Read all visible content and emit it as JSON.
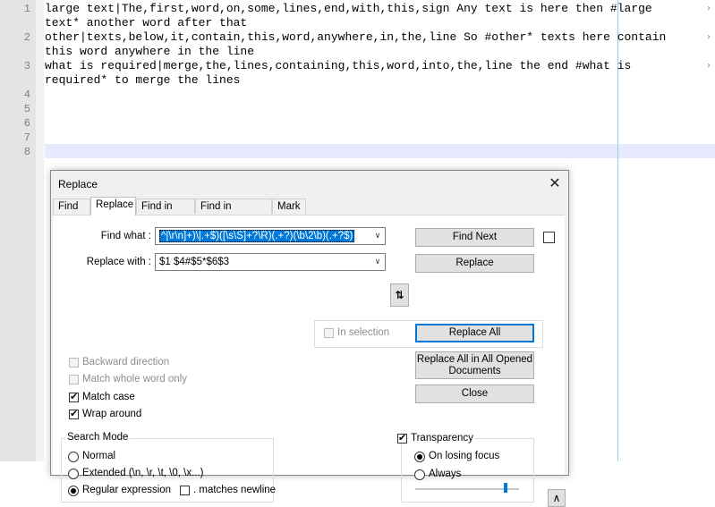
{
  "editor": {
    "line_numbers": [
      "1",
      "2",
      "3",
      "4",
      "5",
      "6",
      "7",
      "8"
    ],
    "lines": [
      "large text|The,first,word,on,some,lines,end,with,this,sign Any text is here then #large",
      "text* another word after that",
      "other|texts,below,it,contain,this,word,anywhere,in,the,line So #other* texts here contain",
      "this word anywhere in the line",
      "what is required|merge,the,lines,containing,this,word,into,the,line the end #what is",
      "required* to merge the lines"
    ],
    "fold_marker": "›"
  },
  "dialog": {
    "title": "Replace",
    "close_glyph": "✕",
    "tabs": [
      "Find",
      "Replace",
      "Find in Files",
      "Find in Projects",
      "Mark"
    ],
    "find_label": "Find what :",
    "find_value": "^|\\r\\n]+)\\|.+$)([\\s\\S]+?\\R)(.+?)(\\b\\2\\b)(.+?$)",
    "replace_label": "Replace with :",
    "replace_value": "$1 $4#$5*$6$3",
    "dropdown_glyph": "∨",
    "swap_glyph": "⇅",
    "buttons": {
      "find_next": "Find Next",
      "replace": "Replace",
      "replace_all": "Replace All",
      "replace_all_opened_1": "Replace All in All Opened",
      "replace_all_opened_2": "Documents",
      "close": "Close"
    },
    "in_selection": "In selection",
    "options": {
      "backward": "Backward direction",
      "whole_word": "Match whole word only",
      "match_case": "Match case",
      "wrap_around": "Wrap around"
    },
    "check_glyph": "✔",
    "search_mode": {
      "title": "Search Mode",
      "normal": "Normal",
      "extended": "Extended (\\n, \\r, \\t, \\0, \\x...)",
      "regex": "Regular expression",
      "matches_newline": ". matches newline"
    },
    "transparency": {
      "title": "Transparency",
      "on_losing_focus": "On losing focus",
      "always": "Always",
      "level": 0.87
    },
    "collapse_glyph": "∧"
  }
}
